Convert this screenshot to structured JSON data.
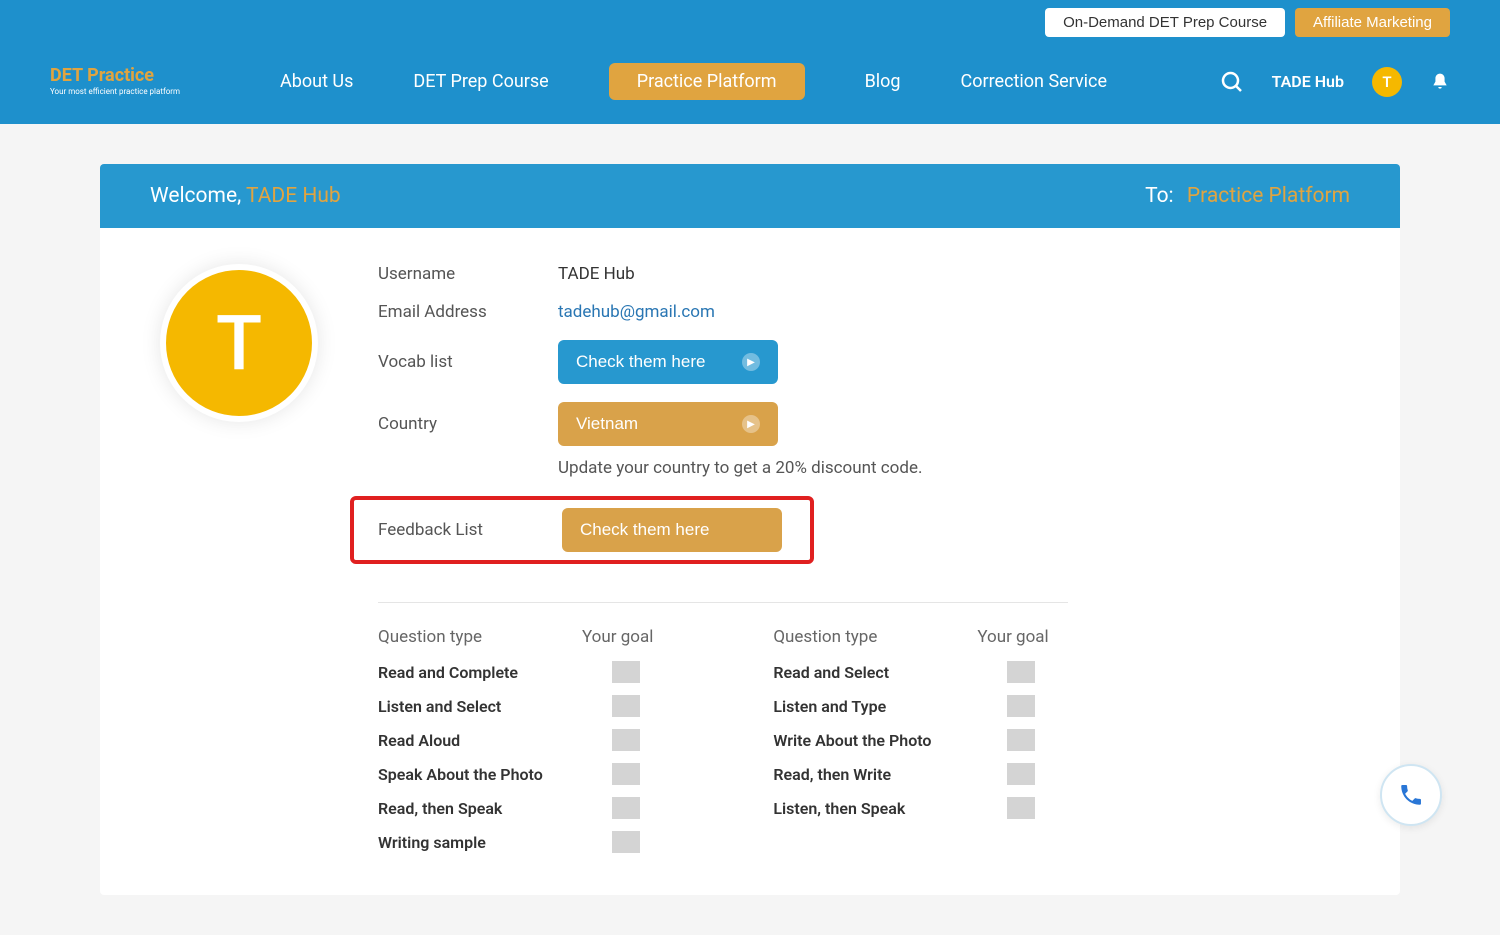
{
  "topBar": {
    "prepCourse": "On-Demand DET Prep Course",
    "affiliate": "Affiliate Marketing"
  },
  "logo": {
    "main": "DET Practice",
    "sub": "Your most efficient practice platform"
  },
  "nav": {
    "about": "About Us",
    "course": "DET Prep Course",
    "platform": "Practice Platform",
    "blog": "Blog",
    "correction": "Correction Service",
    "userName": "TADE Hub",
    "userInitial": "T"
  },
  "welcome": {
    "prefix": "Welcome, ",
    "name": "TADE Hub",
    "toLabel": "To:",
    "toLink": "Practice Platform"
  },
  "profile": {
    "avatarInitial": "T",
    "usernameLabel": "Username",
    "usernameValue": "TADE Hub",
    "emailLabel": "Email Address",
    "emailValue": "tadehub@gmail.com",
    "vocabLabel": "Vocab list",
    "vocabButton": "Check them here",
    "countryLabel": "Country",
    "countryValue": "Vietnam",
    "countryNote": "Update your country to get a 20% discount code.",
    "feedbackLabel": "Feedback List",
    "feedbackButton": "Check them here"
  },
  "goals": {
    "headType": "Question type",
    "headGoal": "Your goal",
    "left": [
      "Read and Complete",
      "Listen and Select",
      "Read Aloud",
      "Speak About the Photo",
      "Read, then Speak",
      "Writing sample"
    ],
    "right": [
      "Read and Select",
      "Listen and Type",
      "Write About the Photo",
      "Read, then Write",
      "Listen, then Speak"
    ]
  }
}
